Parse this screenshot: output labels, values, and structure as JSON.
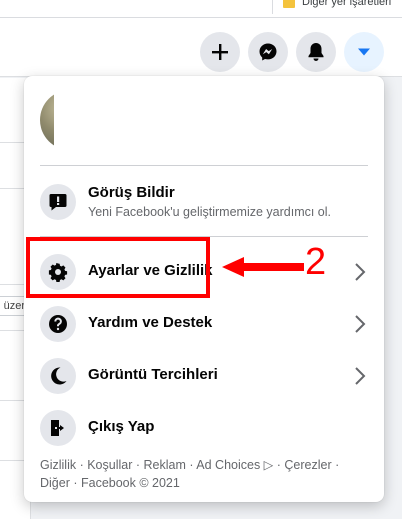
{
  "browser": {
    "bookmarks_label": "Diğer yer işaretleri"
  },
  "header": {
    "buttons": [
      {
        "name": "create",
        "icon": "plus-icon"
      },
      {
        "name": "messenger",
        "icon": "messenger-icon"
      },
      {
        "name": "notifications",
        "icon": "bell-icon"
      },
      {
        "name": "account",
        "icon": "caret-down-icon",
        "active": true
      }
    ]
  },
  "background": {
    "chip_text": "üzer"
  },
  "menu": {
    "feedback": {
      "title": "Görüş Bildir",
      "subtitle": "Yeni Facebook'u geliştirmemize yardımcı ol."
    },
    "items": [
      {
        "label": "Ayarlar ve Gizlilik",
        "icon": "gear-icon"
      },
      {
        "label": "Yardım ve Destek",
        "icon": "help-icon"
      },
      {
        "label": "Görüntü Tercihleri",
        "icon": "moon-icon"
      },
      {
        "label": "Çıkış Yap",
        "icon": "logout-icon"
      }
    ],
    "footer": {
      "line1": "Gizlilik · Koşullar · Reklam · Ad Choices ▷ · Çerezler ·",
      "line2": "Diğer · Facebook © 2021"
    }
  },
  "annotation": {
    "number": "2",
    "color": "#ff0000"
  },
  "colors": {
    "accent": "#1877f2",
    "text_primary": "#050505",
    "text_secondary": "#65676b"
  }
}
